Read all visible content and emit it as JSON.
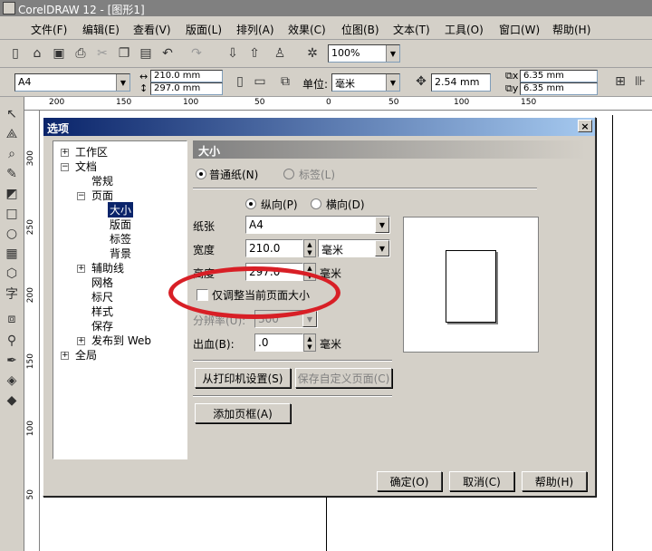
{
  "app": {
    "title": "CorelDRAW 12 - [图形1]"
  },
  "menu": [
    "文件(F)",
    "编辑(E)",
    "查看(V)",
    "版面(L)",
    "排列(A)",
    "效果(C)",
    "位图(B)",
    "文本(T)",
    "工具(O)",
    "窗口(W)",
    "帮助(H)"
  ],
  "toolbar1": {
    "zoom": "100%"
  },
  "toolbar2": {
    "paper": "A4",
    "width": "210.0 mm",
    "height": "297.0 mm",
    "unit_label": "单位:",
    "unit": "毫米",
    "nudge": "2.54 mm",
    "dup_x": "6.35 mm",
    "dup_y": "6.35 mm"
  },
  "ruler": {
    "h": [
      "200",
      "150",
      "100",
      "50",
      "0",
      "50",
      "100",
      "150"
    ],
    "v": [
      "300",
      "250",
      "200",
      "150",
      "100",
      "50"
    ]
  },
  "dialog": {
    "title": "选项",
    "close": "×",
    "tree": [
      {
        "label": "工作区",
        "exp": "+"
      },
      {
        "label": "文档",
        "exp": "−"
      },
      {
        "label": "常规"
      },
      {
        "label": "页面",
        "exp": "−"
      },
      {
        "label": "大小",
        "selected": true
      },
      {
        "label": "版面"
      },
      {
        "label": "标签"
      },
      {
        "label": "背景"
      },
      {
        "label": "辅助线",
        "exp": "+"
      },
      {
        "label": "网格"
      },
      {
        "label": "标尺"
      },
      {
        "label": "样式"
      },
      {
        "label": "保存"
      },
      {
        "label": "发布到 Web",
        "exp": "+"
      },
      {
        "label": "全局",
        "exp": "+"
      }
    ],
    "panel": {
      "header": "大小",
      "normal_paper": "普通纸(N)",
      "label_paper": "标签(L)",
      "portrait": "纵向(P)",
      "landscape": "横向(D)",
      "paper_label": "纸张",
      "paper_value": "A4",
      "width_label": "宽度",
      "width_value": "210.0",
      "width_unit": "毫米",
      "height_label": "高度",
      "height_value": "297.0",
      "height_unit": "毫米",
      "adjust_current": "仅调整当前页面大小",
      "resolution_label": "分辨率(U):",
      "resolution_value": "300",
      "bleed_label": "出血(B):",
      "bleed_value": ".0",
      "bleed_unit": "毫米",
      "from_printer": "从打印机设置(S)",
      "save_custom": "保存自定义页面(C)",
      "add_frame": "添加页框(A)"
    },
    "ok": "确定(O)",
    "cancel": "取消(C)",
    "help": "帮助(H)"
  },
  "colors": {
    "highlight": "#d81f26",
    "title_blue": "#0a246a"
  }
}
